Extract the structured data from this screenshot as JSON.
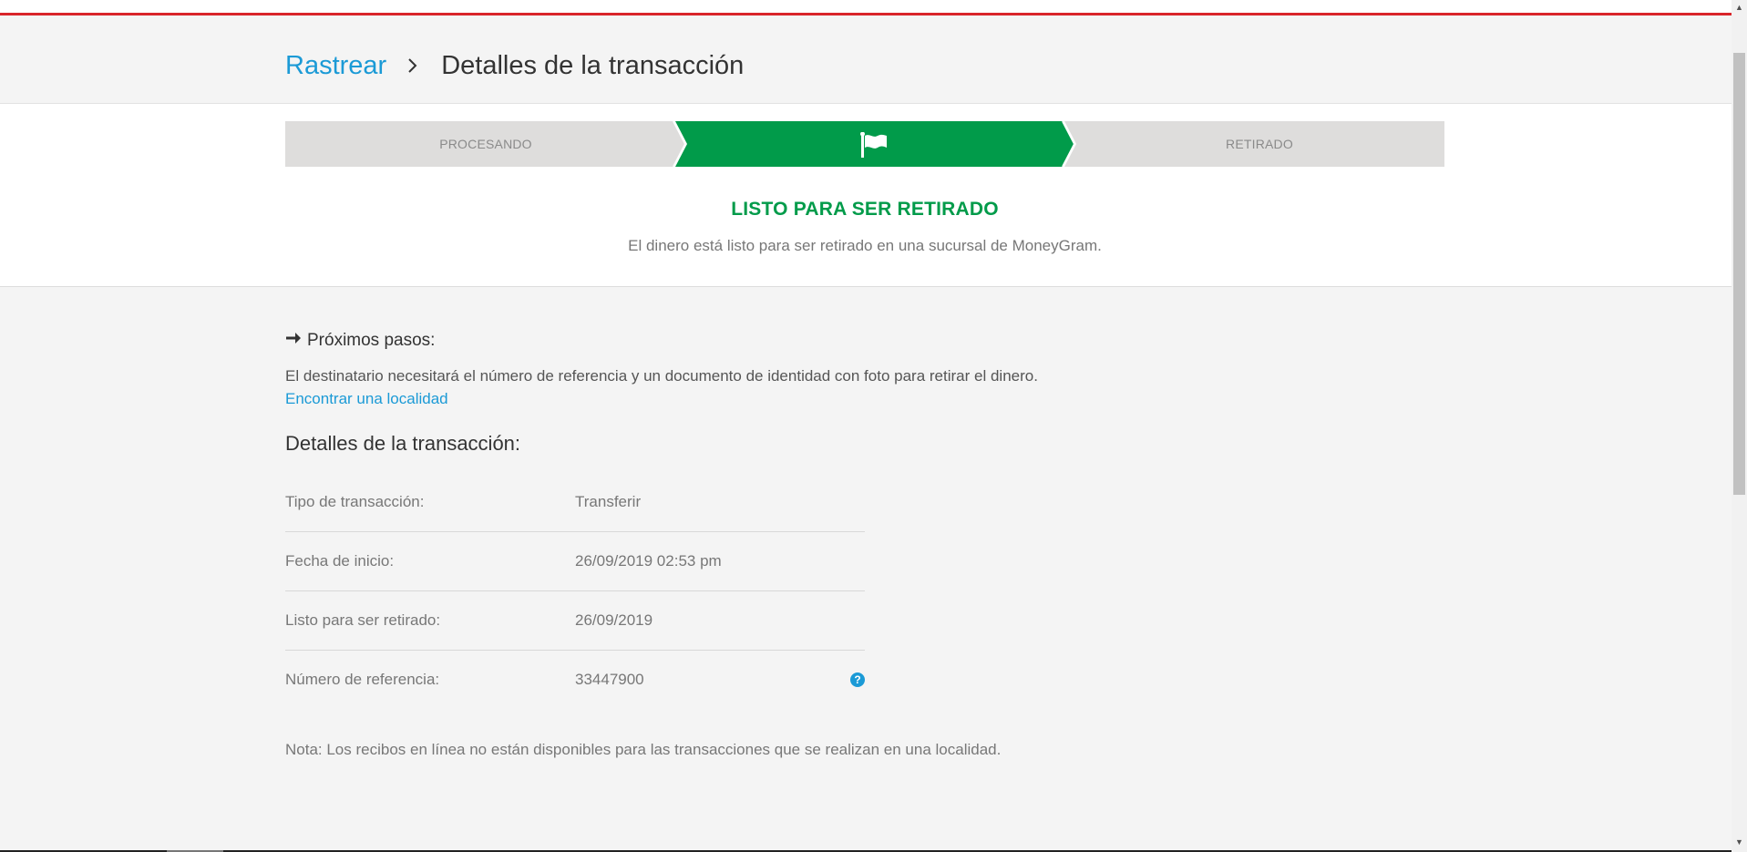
{
  "breadcrumb": {
    "parent": "Rastrear",
    "current": "Detalles de la transacción"
  },
  "stepper": {
    "steps": [
      {
        "label": "PROCESANDO",
        "state": "done"
      },
      {
        "label": "",
        "icon": "flag-icon",
        "state": "active"
      },
      {
        "label": "RETIRADO",
        "state": "pending"
      }
    ],
    "active_color": "#019b4a",
    "inactive_color": "#dedddc"
  },
  "status": {
    "title": "LISTO PARA SER RETIRADO",
    "description": "El dinero está listo para ser retirado en una sucursal de MoneyGram."
  },
  "next_steps": {
    "heading": "Próximos pasos:",
    "text": "El destinatario necesitará el número de referencia y un documento de identidad con foto para retirar el dinero.",
    "link": "Encontrar una localidad"
  },
  "details": {
    "heading": "Detalles de la transacción:",
    "rows": [
      {
        "label": "Tipo de transacción:",
        "value": "Transferir"
      },
      {
        "label": "Fecha de inicio:",
        "value": "26/09/2019 02:53 pm"
      },
      {
        "label": "Listo para ser retirado:",
        "value": "26/09/2019"
      },
      {
        "label": "Número de referencia:",
        "value": "33447900",
        "help_icon": "question-circle-icon"
      }
    ]
  },
  "note": "Nota: Los recibos en línea no están disponibles para las transacciones que se realizan en una localidad.",
  "colors": {
    "brand_red": "#d9252a",
    "link_blue": "#1b9ad6",
    "success_green": "#019b4a"
  }
}
